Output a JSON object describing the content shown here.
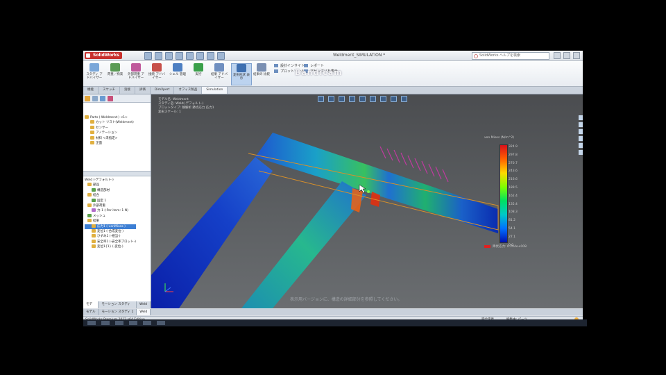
{
  "app": {
    "logo": "SolidWorks",
    "document_title": "Weldment_SIMULATION *",
    "search_placeholder": "SolidWorks ヘルプを検索",
    "watermark": "Bandicam"
  },
  "colors": {
    "ribbon_active": "#bcd3ef",
    "selection": "#3d7fd4",
    "viewport_bg": "#4b4d50",
    "logo_red": "#c8302c"
  },
  "ribbon": {
    "buttons": [
      {
        "label": "スタディ アドバイザー",
        "icon": "study-advisor-icon"
      },
      {
        "label": "荷重／拘束",
        "icon": "fixture-icon"
      },
      {
        "label": "外部荷重 アドバイザー",
        "icon": "external-load-icon"
      },
      {
        "label": "接続 アドバイザー",
        "icon": "connection-icon"
      },
      {
        "label": "シェル 管理",
        "icon": "shell-icon"
      },
      {
        "label": "実行",
        "icon": "run-icon"
      },
      {
        "label": "結果 アドバイザー",
        "icon": "results-advisor-icon"
      },
      {
        "label": "変形形状 表示",
        "icon": "deformed-icon"
      },
      {
        "label": "結果の 比較",
        "icon": "compare-icon"
      }
    ],
    "list_a": [
      "設計インサイト",
      "プロットツール"
    ],
    "list_b": [
      "レポート",
      "アセンブリを表示"
    ]
  },
  "tabs": [
    "機能",
    "スケッチ",
    "溶接",
    "評価",
    "DimXpert",
    "オフィス製品",
    "Simulation"
  ],
  "left_panel": {
    "tree_top": [
      "Parts (-Weldment-) <1>",
      "カット リスト(Weldment)",
      "センサー",
      "アノテーション",
      "材料 <未指定>",
      "正面"
    ],
    "tree_bottom": [
      "Weld (-デフォルト-)",
      "部品",
      "構造部材",
      "結合",
      "固定 1",
      "外部荷重",
      "力-1 (:Per item: 1 N)",
      "メッシュ",
      "結果",
      "応力1 (-vonMises-)",
      "変位1 (-合成変位-)",
      "ひずみ1 (-相当-)",
      "安全率1 (-安全率プロット-)",
      "変位1{1} (-変位-)"
    ],
    "bottom_tabs": [
      "モデル",
      "モーション スタディ 1",
      "Weld"
    ]
  },
  "viewport": {
    "info_lines": [
      "モデル名: Weldment",
      "スタディ名: Weld(-デフォルト-)",
      "プロットタイプ: 静解析 節点応力 応力1",
      "変形スケール: 1"
    ],
    "caption": "表示用バージョンに、構造の詳細部分を参照してください。"
  },
  "chart_data": {
    "type": "heatmap",
    "title": "von Mises (N/m^2)",
    "scale_labels": [
      "324.9",
      "297.8",
      "270.7",
      "243.6",
      "216.6",
      "189.5",
      "162.4",
      "135.4",
      "108.3",
      "81.2",
      "54.1",
      "27.1",
      "0.0"
    ],
    "footer": "降伏応力: 6.204e+008"
  },
  "status": {
    "left": "SolidWorks Premium 2012 x64 Edition",
    "right_a": "完全定義",
    "right_b": "編集中: パーツ"
  }
}
